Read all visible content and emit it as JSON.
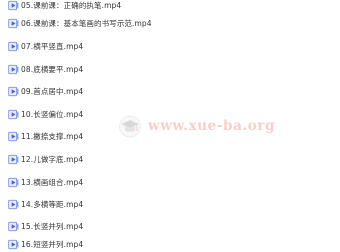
{
  "files": [
    {
      "name": "05.课前课：正确的执笔.mp4",
      "icon": "video-file-icon"
    },
    {
      "name": "06.课前课：基本笔画的书写示范.mp4",
      "icon": "video-file-icon"
    },
    {
      "name": "07.横平竖直.mp4",
      "icon": "video-file-icon"
    },
    {
      "name": "08.底横要平.mp4",
      "icon": "video-file-icon"
    },
    {
      "name": "09.首点居中.mp4",
      "icon": "video-file-icon"
    },
    {
      "name": "10.长竖偏位.mp4",
      "icon": "video-file-icon"
    },
    {
      "name": "11.撇捺支撑.mp4",
      "icon": "video-file-icon"
    },
    {
      "name": "12.儿做字底.mp4",
      "icon": "video-file-icon"
    },
    {
      "name": "13.横画组合.mp4",
      "icon": "video-file-icon"
    },
    {
      "name": "14.多横等距.mp4",
      "icon": "video-file-icon"
    },
    {
      "name": "15.长竖并列.mp4",
      "icon": "video-file-icon"
    },
    {
      "name": "16.短竖并列.mp4",
      "icon": "video-file-icon"
    }
  ],
  "watermark": {
    "text": "www.xue-ba.org",
    "logo": "graduation-cap-icon",
    "color": "#f0a7a1"
  }
}
